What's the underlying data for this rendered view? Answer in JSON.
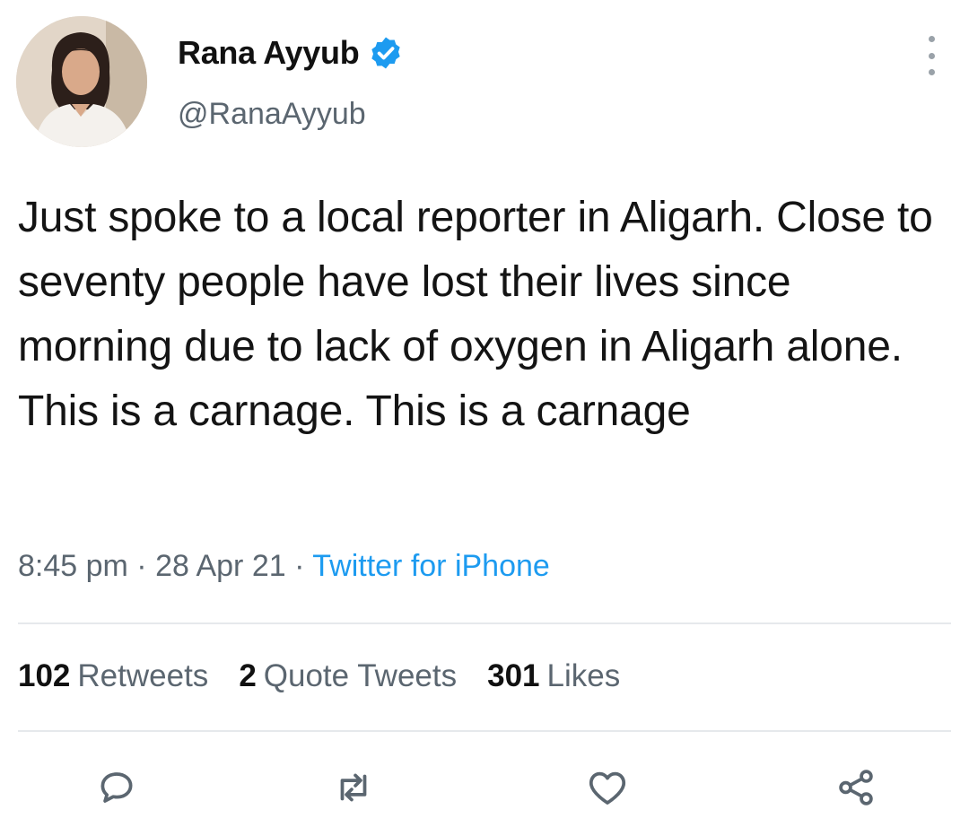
{
  "author": {
    "display_name": "Rana Ayyub",
    "handle": "@RanaAyyub",
    "verified_icon": "verified-badge-icon"
  },
  "tweet": {
    "text": "Just spoke to a local reporter in Aligarh. Close to seventy people have lost their lives since morning due to lack of oxygen in Aligarh alone. This is a carnage. This is a carnage",
    "time": "8:45 pm",
    "date": "28 Apr 21",
    "source": "Twitter for iPhone",
    "separator": " · "
  },
  "stats": {
    "retweets_count": "102",
    "retweets_label": "Retweets",
    "quotes_count": "2",
    "quotes_label": "Quote Tweets",
    "likes_count": "301",
    "likes_label": "Likes"
  },
  "actions": [
    "reply-icon",
    "retweet-icon",
    "like-icon",
    "share-icon"
  ],
  "colors": {
    "accent": "#1d9bf0",
    "muted_text": "#5b6670",
    "divider": "#e6e9ec"
  }
}
